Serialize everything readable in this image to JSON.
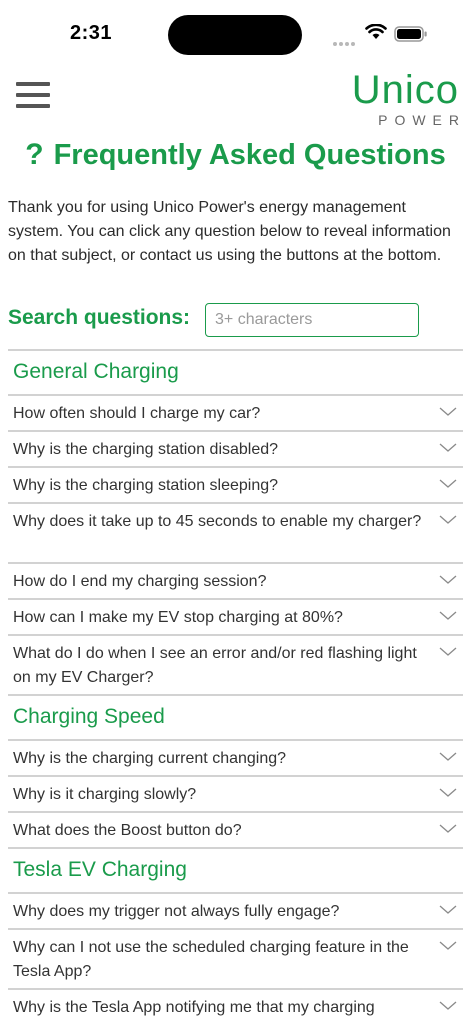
{
  "status_bar": {
    "time": "2:31"
  },
  "header": {
    "logo_main": "Unico",
    "logo_sub": "POWER"
  },
  "page": {
    "title_icon": "?",
    "title": "Frequently Asked Questions",
    "intro": "Thank you for using Unico Power's energy management system. You can click any question below to reveal information on that subject, or contact us using the buttons at the bottom."
  },
  "search": {
    "label": "Search questions:",
    "placeholder": "3+ characters",
    "value": ""
  },
  "sections": [
    {
      "title": "General Charging",
      "questions": [
        "How often should I charge my car?",
        "Why is the charging station disabled?",
        "Why is the charging station sleeping?",
        "Why does it take up to 45 seconds to enable my charger?",
        "How do I end my charging session?",
        "How can I make my EV stop charging at 80%?",
        "What do I do when I see an error and/or red flashing light on my EV Charger?"
      ]
    },
    {
      "title": "Charging Speed",
      "questions": [
        "Why is the charging current changing?",
        "Why is it charging slowly?",
        "What does the Boost button do?"
      ]
    },
    {
      "title": "Tesla EV Charging",
      "questions": [
        "Why does my trigger not always fully engage?",
        "Why can I not use the scheduled charging feature in the Tesla App?",
        "Why is the Tesla App notifying me that my charging"
      ]
    }
  ],
  "icons": {
    "menu": "hamburger-menu-icon",
    "chevron": "chevron-down-icon",
    "wifi": "wifi-icon",
    "battery": "battery-icon",
    "question": "question-mark-icon"
  },
  "colors": {
    "brand_green": "#1a9b4b",
    "divider": "#d2d2d2",
    "text": "#2b2b2b"
  }
}
